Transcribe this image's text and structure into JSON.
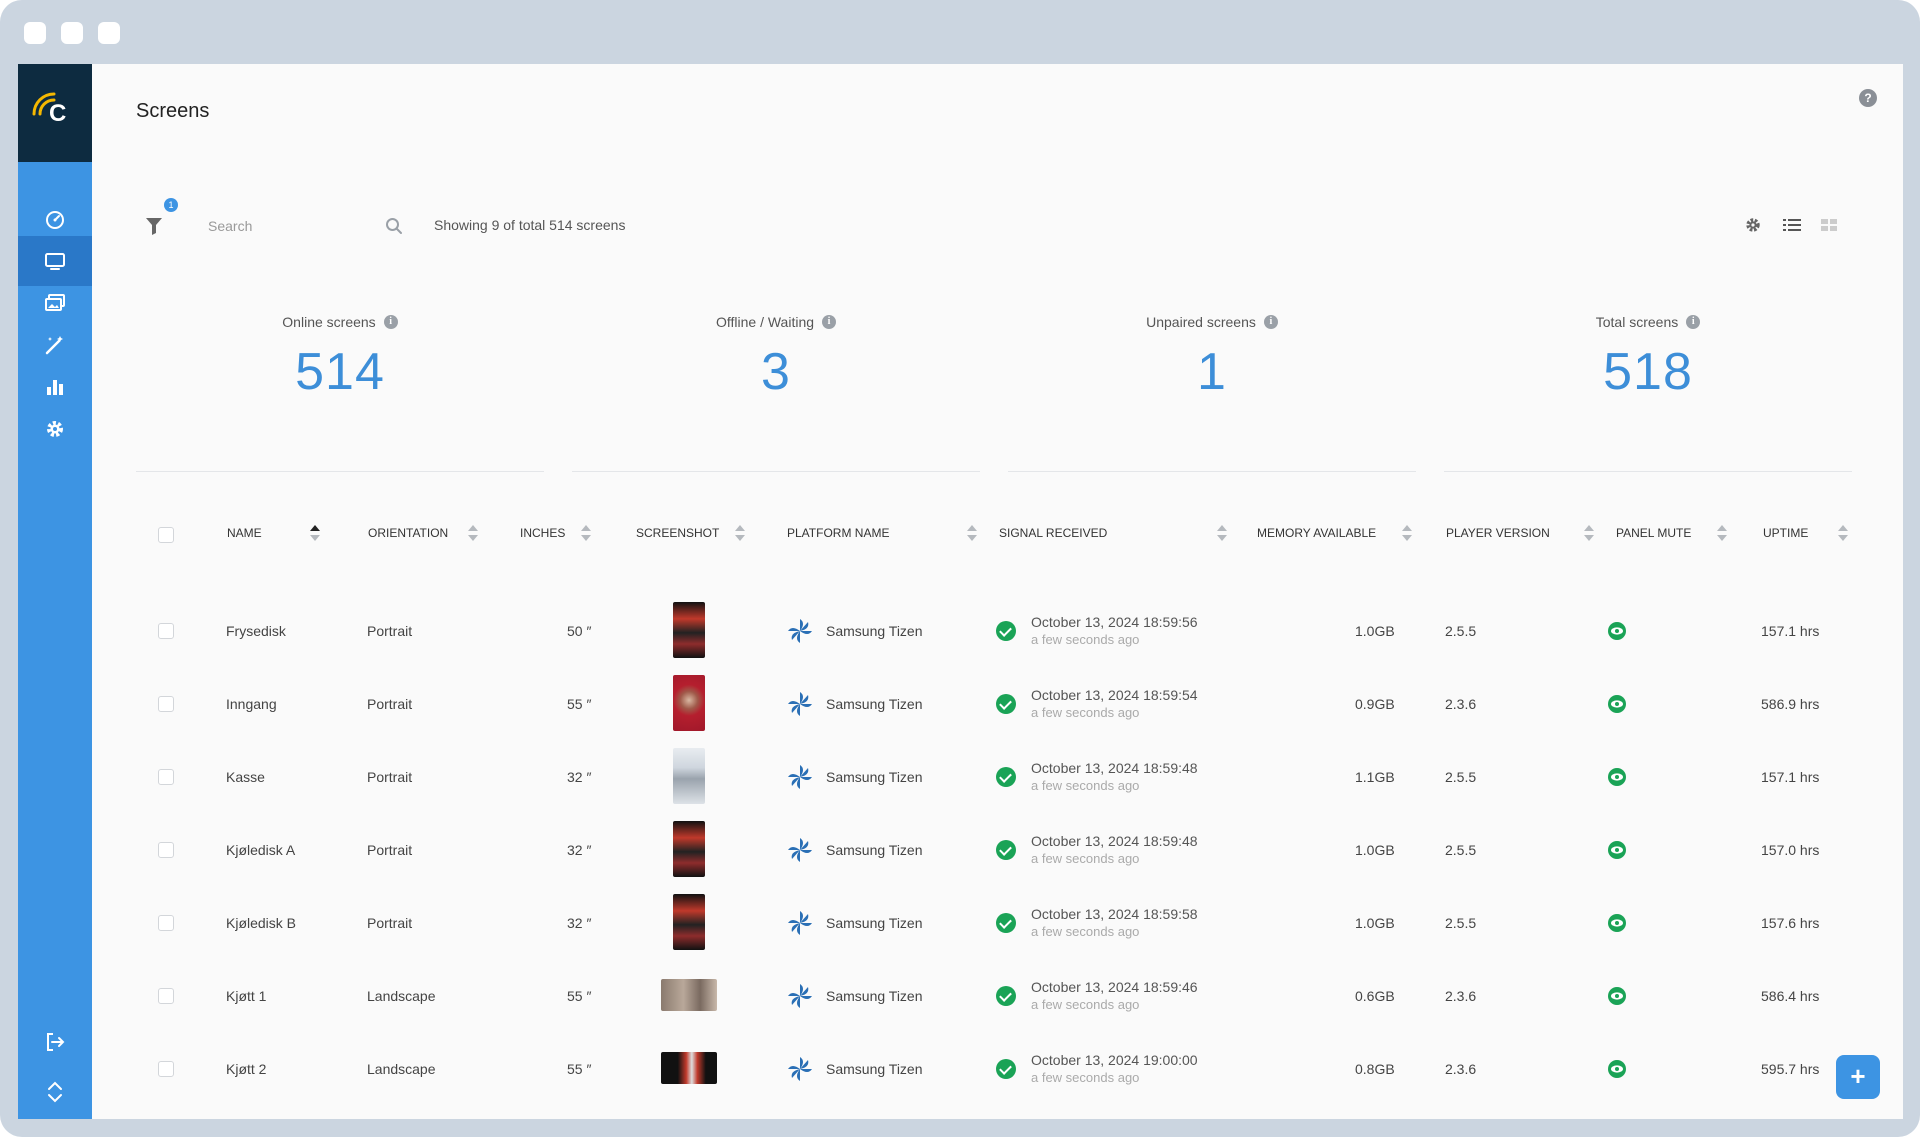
{
  "page": {
    "title": "Screens"
  },
  "toolbar": {
    "filter_count": "1",
    "search_placeholder": "Search",
    "showing_text": "Showing 9 of total 514 screens"
  },
  "stats": [
    {
      "label": "Online screens",
      "value": "514"
    },
    {
      "label": "Offline / Waiting",
      "value": "3"
    },
    {
      "label": "Unpaired screens",
      "value": "1"
    },
    {
      "label": "Total screens",
      "value": "518"
    }
  ],
  "table": {
    "columns": {
      "name": "NAME",
      "orientation": "ORIENTATION",
      "inches": "INCHES",
      "screenshot": "SCREENSHOT",
      "platform": "PLATFORM NAME",
      "signal": "SIGNAL RECEIVED",
      "memory": "MEMORY AVAILABLE",
      "player": "PLAYER VERSION",
      "mute": "PANEL MUTE",
      "uptime": "UPTIME"
    },
    "rows": [
      {
        "name": "Frysedisk",
        "orientation": "Portrait",
        "inches": "50 ″",
        "platform": "Samsung Tizen",
        "signal_date": "October 13, 2024 18:59:56",
        "signal_ago": "a few seconds ago",
        "memory": "1.0GB",
        "player": "2.5.5",
        "uptime": "157.1 hrs"
      },
      {
        "name": "Inngang",
        "orientation": "Portrait",
        "inches": "55 ″",
        "platform": "Samsung Tizen",
        "signal_date": "October 13, 2024 18:59:54",
        "signal_ago": "a few seconds ago",
        "memory": "0.9GB",
        "player": "2.3.6",
        "uptime": "586.9 hrs"
      },
      {
        "name": "Kasse",
        "orientation": "Portrait",
        "inches": "32 ″",
        "platform": "Samsung Tizen",
        "signal_date": "October 13, 2024 18:59:48",
        "signal_ago": "a few seconds ago",
        "memory": "1.1GB",
        "player": "2.5.5",
        "uptime": "157.1 hrs"
      },
      {
        "name": "Kjøledisk A",
        "orientation": "Portrait",
        "inches": "32 ″",
        "platform": "Samsung Tizen",
        "signal_date": "October 13, 2024 18:59:48",
        "signal_ago": "a few seconds ago",
        "memory": "1.0GB",
        "player": "2.5.5",
        "uptime": "157.0 hrs"
      },
      {
        "name": "Kjøledisk B",
        "orientation": "Portrait",
        "inches": "32 ″",
        "platform": "Samsung Tizen",
        "signal_date": "October 13, 2024 18:59:58",
        "signal_ago": "a few seconds ago",
        "memory": "1.0GB",
        "player": "2.5.5",
        "uptime": "157.6 hrs"
      },
      {
        "name": "Kjøtt 1",
        "orientation": "Landscape",
        "inches": "55 ″",
        "platform": "Samsung Tizen",
        "signal_date": "October 13, 2024 18:59:46",
        "signal_ago": "a few seconds ago",
        "memory": "0.6GB",
        "player": "2.3.6",
        "uptime": "586.4 hrs"
      },
      {
        "name": "Kjøtt 2",
        "orientation": "Landscape",
        "inches": "55 ″",
        "platform": "Samsung Tizen",
        "signal_date": "October 13, 2024 19:00:00",
        "signal_ago": "a few seconds ago",
        "memory": "0.8GB",
        "player": "2.3.6",
        "uptime": "595.7 hrs"
      }
    ]
  },
  "fab": {
    "label": "+"
  },
  "colors": {
    "accent": "#3d94e3",
    "sidebar_dark": "#0d2b40",
    "ok_green": "#1aa356",
    "stat_blue": "#3d8ed8"
  }
}
